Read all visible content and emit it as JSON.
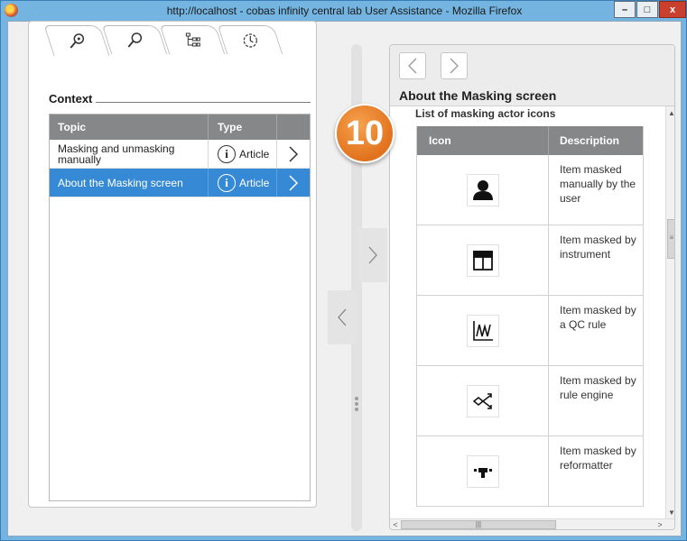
{
  "window": {
    "title": "http://localhost - cobas infinity central lab User Assistance - Mozilla Firefox",
    "controls": {
      "minimize": "–",
      "maximize": "□",
      "close": "x"
    }
  },
  "left_panel": {
    "tabs": [
      {
        "icon": "search-detail-icon",
        "active": true
      },
      {
        "icon": "search-icon",
        "active": false
      },
      {
        "icon": "tree-icon",
        "active": false
      },
      {
        "icon": "history-icon",
        "active": false
      }
    ],
    "context_title": "Context",
    "table": {
      "headers": {
        "topic": "Topic",
        "type": "Type"
      },
      "rows": [
        {
          "topic": "Masking and unmasking manually",
          "type": "Article",
          "selected": false
        },
        {
          "topic": "About the Masking screen",
          "type": "Article",
          "selected": true
        }
      ]
    }
  },
  "right_panel": {
    "heading": "About the Masking screen",
    "section_title": "List of masking actor icons",
    "table": {
      "headers": {
        "icon": "Icon",
        "description": "Description"
      },
      "rows": [
        {
          "icon": "user-icon",
          "description": "Item masked manually by the user"
        },
        {
          "icon": "instrument-icon",
          "description": "Item masked by instrument"
        },
        {
          "icon": "qc-rule-icon",
          "description": "Item masked by a QC rule"
        },
        {
          "icon": "rule-engine-icon",
          "description": "Item masked by rule engine"
        },
        {
          "icon": "reformatter-icon",
          "description": "Item masked by reformatter"
        }
      ]
    }
  },
  "step_badge": "10",
  "colors": {
    "table_header": "#858789",
    "selected_row": "#3689d4",
    "badge": "#e8761f",
    "window_frame": "#74b4e0"
  }
}
